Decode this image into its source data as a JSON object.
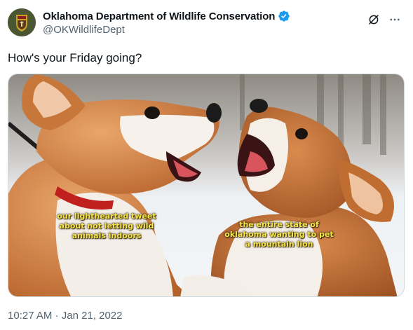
{
  "author": {
    "name": "Oklahoma Department of Wildlife Conservation",
    "handle": "@OKWildlifeDept",
    "verified": true,
    "verified_color": "#1d9bf0"
  },
  "tweet": {
    "text": "How's your Friday going?"
  },
  "media": {
    "captions": {
      "left": "our lighthearted tweet about not letting wild animals indoors",
      "right": "the entire state of oklahoma wanting to pet a mountain lion"
    },
    "caption_color": "#f5e64a"
  },
  "meta": {
    "time": "10:27 AM",
    "separator": "·",
    "date": "Jan 21, 2022"
  },
  "icons": {
    "grok": "grok-icon",
    "more": "more-icon",
    "verified": "verified-badge-icon"
  }
}
